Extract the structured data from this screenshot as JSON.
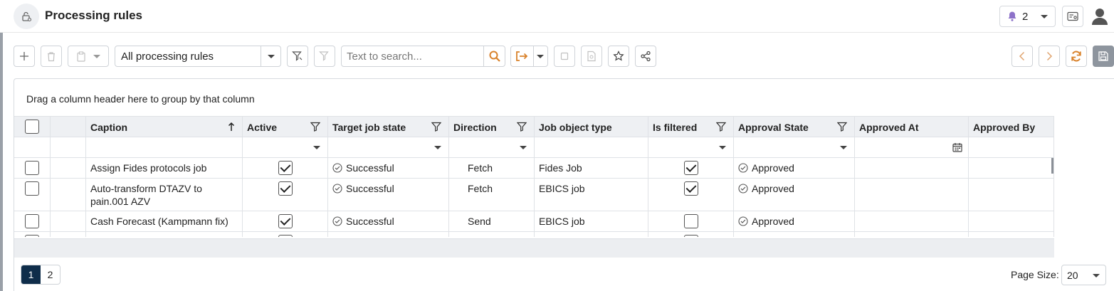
{
  "header": {
    "title": "Processing rules",
    "notification_count": "2"
  },
  "toolbar": {
    "rule_filter_value": "All processing rules",
    "search_placeholder": "Text to search..."
  },
  "grid": {
    "group_hint": "Drag a column header here to group by that column",
    "columns": {
      "caption": "Caption",
      "active": "Active",
      "target_job_state": "Target job state",
      "direction": "Direction",
      "job_object_type": "Job object type",
      "is_filtered": "Is filtered",
      "approval_state": "Approval State",
      "approved_at": "Approved At",
      "approved_by": "Approved By"
    },
    "rows": [
      {
        "caption_line1": "Assign Fides protocols job",
        "caption_line2": "",
        "active": true,
        "target_job_state": "Successful",
        "direction": "Fetch",
        "job_object_type": "Fides Job",
        "is_filtered": true,
        "approval_state": "Approved",
        "approved_at": "",
        "approved_by": ""
      },
      {
        "caption_line1": "Auto-transform DTAZV to",
        "caption_line2": "pain.001 AZV",
        "active": true,
        "target_job_state": "Successful",
        "direction": "Fetch",
        "job_object_type": "EBICS job",
        "is_filtered": true,
        "approval_state": "Approved",
        "approved_at": "",
        "approved_by": ""
      },
      {
        "caption_line1": "Cash Forecast (Kampmann fix)",
        "caption_line2": "",
        "active": true,
        "target_job_state": "Successful",
        "direction": "Send",
        "job_object_type": "EBICS job",
        "is_filtered": false,
        "approval_state": "Approved",
        "approved_at": "",
        "approved_by": ""
      }
    ]
  },
  "pager": {
    "pages": [
      "1",
      "2"
    ],
    "active_page": "1",
    "page_size_label": "Page Size:",
    "page_size_value": "20"
  },
  "colors": {
    "accent_orange": "#d9822b",
    "pager_active": "#0f2d4a",
    "header_bg": "#eef0f3"
  }
}
